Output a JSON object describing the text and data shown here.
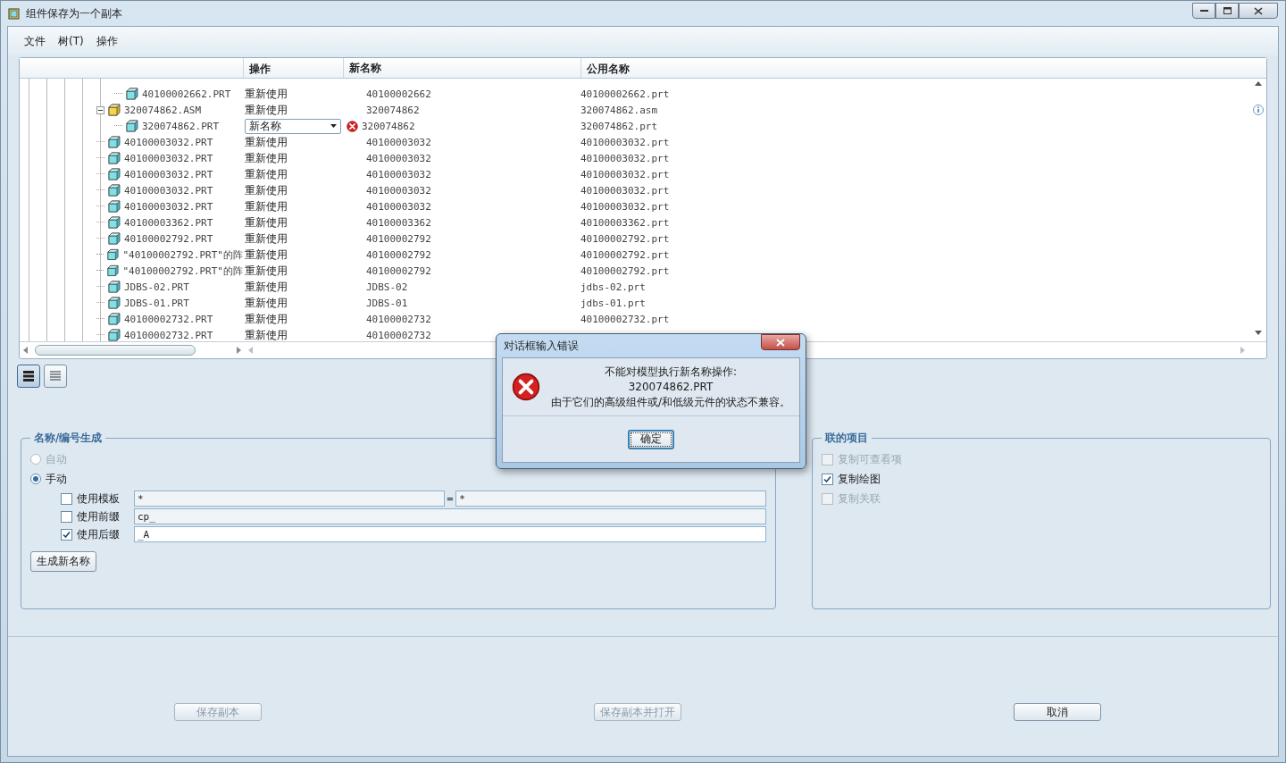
{
  "window": {
    "title": "组件保存为一个副本"
  },
  "menu": [
    "文件",
    "树(T)",
    "操作"
  ],
  "table": {
    "columns": [
      "操作",
      "新名称",
      "公用名称"
    ],
    "rows": [
      {
        "children": [
          {
            "kind": "part",
            "name": "40100002662.PRT",
            "action": "重新使用",
            "new_name": "40100002662",
            "public_name": "40100002662.prt"
          }
        ]
      },
      {
        "kind": "assembly",
        "expanded": true,
        "name": "320074862.ASM",
        "action": "重新使用",
        "new_name": "320074862",
        "public_name": "320074862.asm",
        "children": [
          {
            "kind": "part",
            "name": "320074862.PRT",
            "action": "新名称",
            "dropdown": true,
            "error": true,
            "new_name": "320074862",
            "public_name": "320074862.prt"
          }
        ]
      },
      {
        "kind": "part",
        "name": "40100003032.PRT",
        "action": "重新使用",
        "new_name": "40100003032",
        "public_name": "40100003032.prt"
      },
      {
        "kind": "part",
        "name": "40100003032.PRT",
        "action": "重新使用",
        "new_name": "40100003032",
        "public_name": "40100003032.prt"
      },
      {
        "kind": "part",
        "name": "40100003032.PRT",
        "action": "重新使用",
        "new_name": "40100003032",
        "public_name": "40100003032.prt"
      },
      {
        "kind": "part",
        "name": "40100003032.PRT",
        "action": "重新使用",
        "new_name": "40100003032",
        "public_name": "40100003032.prt"
      },
      {
        "kind": "part",
        "name": "40100003032.PRT",
        "action": "重新使用",
        "new_name": "40100003032",
        "public_name": "40100003032.prt"
      },
      {
        "kind": "part",
        "name": "40100003362.PRT",
        "action": "重新使用",
        "new_name": "40100003362",
        "public_name": "40100003362.prt"
      },
      {
        "kind": "part",
        "name": "40100002792.PRT",
        "action": "重新使用",
        "new_name": "40100002792",
        "public_name": "40100002792.prt"
      },
      {
        "kind": "part",
        "name": "\"40100002792.PRT\"的阵",
        "action": "重新使用",
        "new_name": "40100002792",
        "public_name": "40100002792.prt"
      },
      {
        "kind": "part",
        "name": "\"40100002792.PRT\"的阵",
        "action": "重新使用",
        "new_name": "40100002792",
        "public_name": "40100002792.prt"
      },
      {
        "kind": "part",
        "name": "JDBS-02.PRT",
        "action": "重新使用",
        "new_name": "JDBS-02",
        "public_name": "jdbs-02.prt"
      },
      {
        "kind": "part",
        "name": "JDBS-01.PRT",
        "action": "重新使用",
        "new_name": "JDBS-01",
        "public_name": "jdbs-01.prt"
      },
      {
        "kind": "part",
        "name": "40100002732.PRT",
        "action": "重新使用",
        "new_name": "40100002732",
        "public_name": "40100002732.prt"
      },
      {
        "kind": "part",
        "name": "40100002732.PRT",
        "action": "重新使用",
        "new_name": "40100002732"
      }
    ]
  },
  "view_buttons": [
    {
      "kind": "detail",
      "selected": true
    },
    {
      "kind": "list",
      "selected": false
    }
  ],
  "naming": {
    "title": "名称/编号生成",
    "modes": [
      {
        "label": "自动",
        "selected": false,
        "disabled": true
      },
      {
        "label": "手动",
        "selected": true,
        "disabled": false
      }
    ],
    "options": [
      {
        "label": "使用模板",
        "checked": false,
        "values": [
          "*",
          "*"
        ],
        "separator": "="
      },
      {
        "label": "使用前缀",
        "checked": false,
        "values": [
          "cp_"
        ]
      },
      {
        "label": "使用后缀",
        "checked": true,
        "values": [
          "_A"
        ]
      }
    ],
    "button": "生成新名称"
  },
  "related": {
    "title": "联的项目",
    "items": [
      {
        "label": "复制可查看项",
        "checked": false,
        "disabled": true
      },
      {
        "label": "复制绘图",
        "checked": true,
        "disabled": false
      },
      {
        "label": "复制关联",
        "checked": false,
        "disabled": true
      }
    ]
  },
  "buttons": [
    {
      "label": "保存副本",
      "disabled": true
    },
    {
      "label": "保存副本并打开",
      "disabled": true
    },
    {
      "label": "取消",
      "disabled": false
    }
  ],
  "dialog": {
    "title": "对话框输入错误",
    "lines": [
      "不能对模型执行新名称操作:",
      "320074862.PRT",
      "由于它们的高级组件或/和低级元件的状态不兼容。"
    ],
    "button": "确定"
  }
}
